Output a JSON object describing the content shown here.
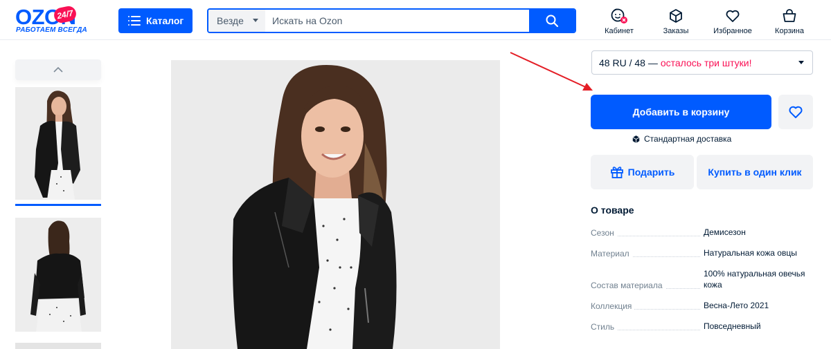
{
  "header": {
    "logo": {
      "word": "OZON",
      "badge": "24/7",
      "tagline": "РАБОТАЕМ ВСЕГДА"
    },
    "catalog_label": "Каталог",
    "search": {
      "scope": "Везде",
      "placeholder": "Искать на Ozon",
      "value": ""
    },
    "nav": [
      {
        "label": "Кабинет",
        "icon": "profile-icon"
      },
      {
        "label": "Заказы",
        "icon": "box-icon"
      },
      {
        "label": "Избранное",
        "icon": "heart-icon"
      },
      {
        "label": "Корзина",
        "icon": "cart-icon"
      }
    ]
  },
  "colors": {
    "brand": "#005bff",
    "accent": "#f91155",
    "text": "#001a34",
    "muted": "#70808f",
    "button_bg": "#f2f3f5"
  },
  "gallery": {
    "thumbnails": [
      {
        "view": "front",
        "selected": true
      },
      {
        "view": "back",
        "selected": false
      }
    ]
  },
  "product": {
    "size_select": {
      "value": "48 RU / 48 —",
      "stock_note": "осталось три штуки!"
    },
    "add_to_cart_label": "Добавить в корзину",
    "delivery_label": "Стандартная доставка",
    "gift_label": "Подарить",
    "one_click_label": "Купить в один клик",
    "about": {
      "title": "О товаре",
      "specs": [
        {
          "key": "Сезон",
          "value": "Демисезон"
        },
        {
          "key": "Материал",
          "value": "Натуральная кожа овцы"
        },
        {
          "key": "Состав материала",
          "value": "100% натуральная овечья кожа"
        },
        {
          "key": "Коллекция",
          "value": "Весна-Лето 2021"
        },
        {
          "key": "Стиль",
          "value": "Повседневный"
        }
      ]
    }
  }
}
